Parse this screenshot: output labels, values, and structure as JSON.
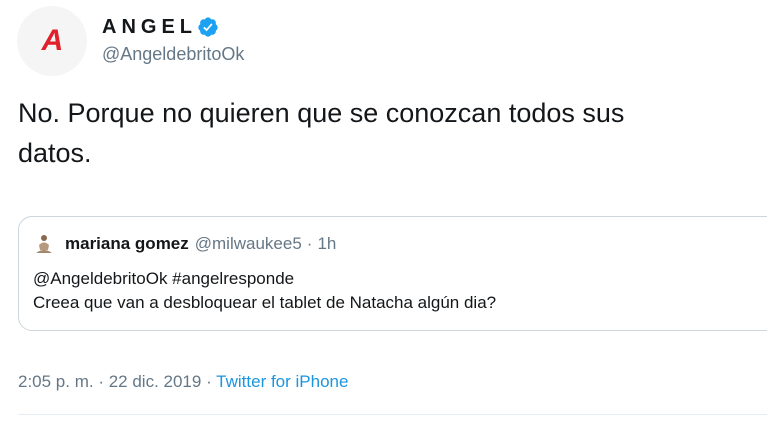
{
  "author": {
    "avatar_letter": "A",
    "display_name": "ANGEL",
    "handle": "@AngeldebritoOk",
    "verified": true
  },
  "tweet": {
    "text_line1": "No. Porque no quieren que se conozcan todos sus",
    "text_line2": "datos."
  },
  "quoted_tweet": {
    "name": "mariana gomez",
    "handle": "@milwaukee5",
    "separator": "·",
    "time": "1h",
    "body_line1": "@AngeldebritoOk #angelresponde",
    "body_line2": "Creea que van a desbloquear el tablet de Natacha algún dia?"
  },
  "meta": {
    "timestamp": "2:05 p. m. · 22 dic. 2019",
    "separator": "·",
    "source": "Twitter for iPhone"
  },
  "colors": {
    "verified": "#1da1f2",
    "link": "#1b95e0",
    "secondary_text": "#657786",
    "avatar_letter": "#e0202a"
  }
}
